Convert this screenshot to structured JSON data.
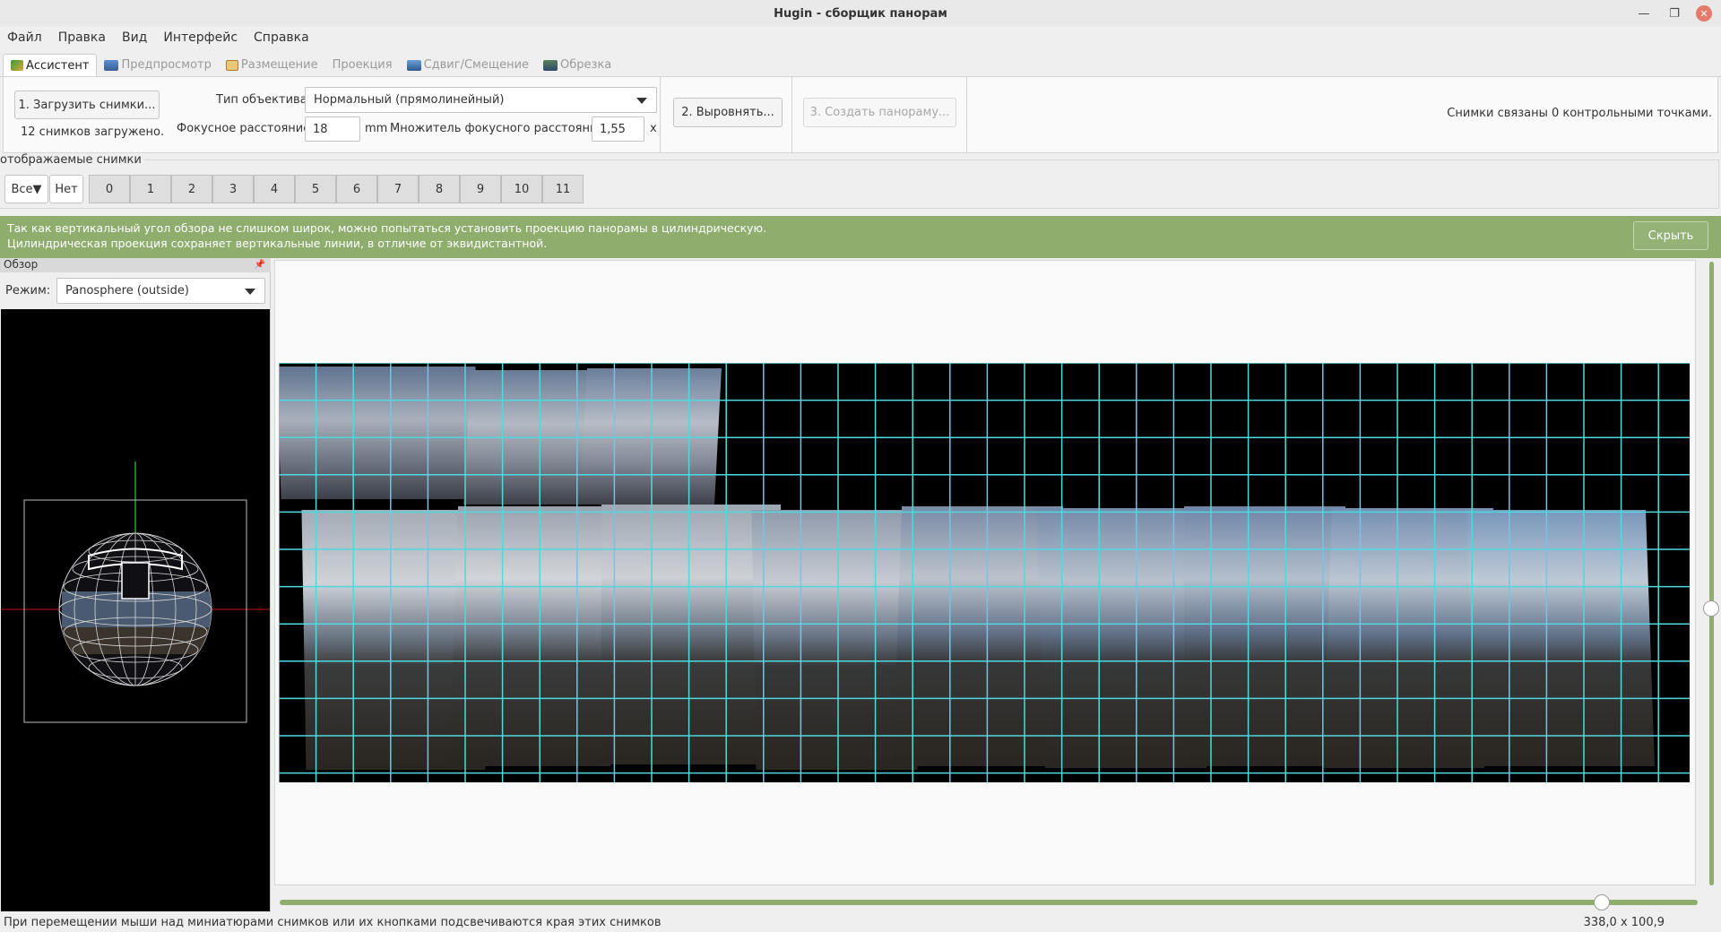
{
  "window": {
    "title": "Hugin - сборщик панорам"
  },
  "menu": [
    "Файл",
    "Правка",
    "Вид",
    "Интерфейс",
    "Справка"
  ],
  "tabs": [
    {
      "label": "Ассистент",
      "icon": "wand-icon",
      "active": true
    },
    {
      "label": "Предпросмотр",
      "icon": "preview-icon"
    },
    {
      "label": "Размещение",
      "icon": "layout-icon"
    },
    {
      "label": "Проекция",
      "icon": ""
    },
    {
      "label": "Сдвиг/Смещение",
      "icon": "move-icon"
    },
    {
      "label": "Обрезка",
      "icon": "crop-icon"
    }
  ],
  "assistant": {
    "load_button": "1. Загрузить снимки...",
    "loaded_status": "12 снимков загружено.",
    "lens_type_label": "Тип объектива:",
    "lens_type_value": "Нормальный (прямолинейный)",
    "focal_label": "Фокусное расстояние:",
    "focal_value": "18",
    "focal_unit": "mm",
    "crop_label": "Множитель фокусного расстояния:",
    "crop_value": "1,55",
    "crop_unit": "x",
    "align_button": "2. Выровнять...",
    "create_button": "3. Создать панораму...",
    "cp_status": "Снимки связаны 0 контрольными точками."
  },
  "image_selector": {
    "legend": "отображаемые снимки",
    "all_button": "Все▼",
    "none_button": "Нет",
    "images": [
      "0",
      "1",
      "2",
      "3",
      "4",
      "5",
      "6",
      "7",
      "8",
      "9",
      "10",
      "11"
    ]
  },
  "info_bar": {
    "line1": "Так как вертикальный угол обзора не слишком широк, можно попытаться установить проекцию панорамы в цилиндрическую.",
    "line2": "Цилиндрическая проекция сохраняет вертикальные линии, в отличие от эквидистантной.",
    "hide_button": "Скрыть"
  },
  "overview": {
    "title": "Обзор",
    "mode_label": "Режим:",
    "mode_value": "Panosphere (outside)"
  },
  "status": {
    "message": "При перемещении мыши над миниатюрами снимков или их кнопками подсвечиваются края этих снимков",
    "coords": "338,0 x 100,9"
  },
  "colors": {
    "accent_green": "#8fae6e",
    "grid_cyan": "#4fd8e0"
  }
}
